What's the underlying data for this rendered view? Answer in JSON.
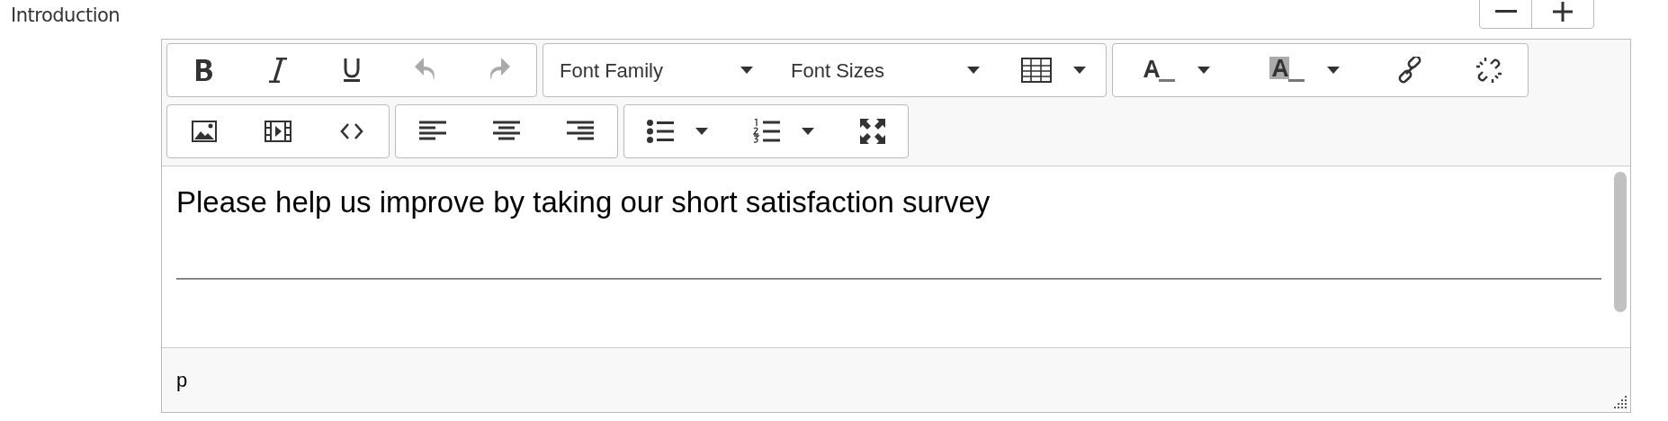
{
  "field": {
    "label": "Introduction"
  },
  "toolbar": {
    "rows": [
      {
        "groups": [
          {
            "tools": [
              {
                "kind": "bold",
                "disabled": false
              },
              {
                "kind": "italic",
                "disabled": false
              },
              {
                "kind": "underline",
                "disabled": false
              },
              {
                "kind": "undo",
                "disabled": true
              },
              {
                "kind": "redo",
                "disabled": true
              }
            ]
          },
          {
            "tools": [
              {
                "kind": "fontfamily",
                "label": "Font Family",
                "disabled": false
              },
              {
                "kind": "fontsize",
                "label": "Font Sizes",
                "disabled": false
              },
              {
                "kind": "table",
                "disabled": false
              }
            ]
          },
          {
            "tools": [
              {
                "kind": "forecolor",
                "disabled": false
              },
              {
                "kind": "backcolor",
                "disabled": false
              },
              {
                "kind": "link",
                "disabled": false
              },
              {
                "kind": "unlink",
                "disabled": false
              }
            ]
          }
        ]
      },
      {
        "groups": [
          {
            "tools": [
              {
                "kind": "image",
                "disabled": false
              },
              {
                "kind": "media",
                "disabled": false
              },
              {
                "kind": "code",
                "disabled": false
              }
            ]
          },
          {
            "tools": [
              {
                "kind": "alignleft",
                "disabled": false
              },
              {
                "kind": "aligncenter",
                "disabled": false
              },
              {
                "kind": "alignright",
                "disabled": false
              }
            ]
          },
          {
            "tools": [
              {
                "kind": "bullist",
                "disabled": false
              },
              {
                "kind": "numlist",
                "disabled": false
              },
              {
                "kind": "fullscreen",
                "disabled": false
              }
            ]
          }
        ]
      }
    ]
  },
  "content": {
    "paragraph": "Please help us improve by taking our short satisfaction survey",
    "horizontal_rule": true
  },
  "status_bar": {
    "path": "p"
  }
}
